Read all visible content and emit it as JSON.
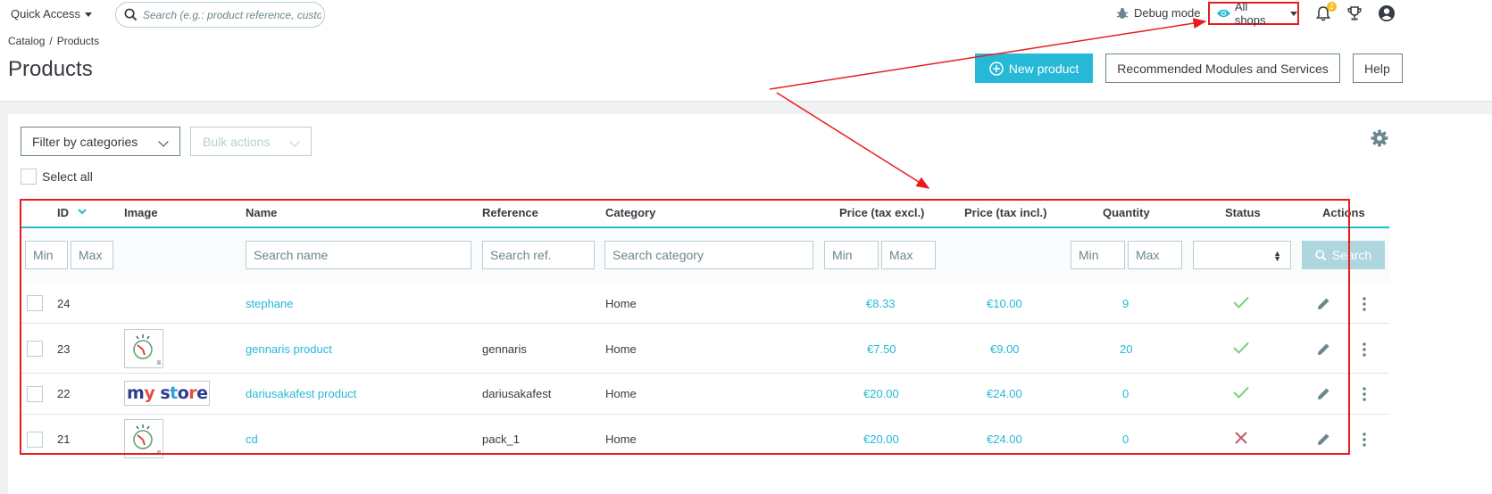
{
  "header": {
    "quick_access": "Quick Access",
    "search_placeholder": "Search (e.g.: product reference, custome",
    "debug_mode": "Debug mode",
    "shop_selector": "All shops",
    "notification_count": "2"
  },
  "breadcrumb": {
    "items": [
      "Catalog",
      "Products"
    ],
    "separator": "/"
  },
  "page": {
    "title": "Products",
    "new_product": "New product",
    "recommended": "Recommended Modules and Services",
    "help": "Help"
  },
  "toolbar": {
    "filter_by_categories": "Filter by categories",
    "bulk_actions": "Bulk actions",
    "select_all": "Select all"
  },
  "table": {
    "columns": [
      "ID",
      "Image",
      "Name",
      "Reference",
      "Category",
      "Price (tax excl.)",
      "Price (tax incl.)",
      "Quantity",
      "Status",
      "Actions"
    ],
    "filters": {
      "min": "Min",
      "max": "Max",
      "search_name": "Search name",
      "search_ref": "Search ref.",
      "search_category": "Search category",
      "search_button": "Search"
    },
    "rows": [
      {
        "id": "24",
        "image": "",
        "name": "stephane",
        "reference": "",
        "category": "Home",
        "price_excl": "€8.33",
        "price_incl": "€10.00",
        "quantity": "9",
        "status": "enabled"
      },
      {
        "id": "23",
        "image": "product-thumbnail",
        "name": "gennaris product",
        "reference": "gennaris",
        "category": "Home",
        "price_excl": "€7.50",
        "price_incl": "€9.00",
        "quantity": "20",
        "status": "enabled"
      },
      {
        "id": "22",
        "image": "my store",
        "name": "dariusakafest product",
        "reference": "dariusakafest",
        "category": "Home",
        "price_excl": "€20.00",
        "price_incl": "€24.00",
        "quantity": "0",
        "status": "enabled"
      },
      {
        "id": "21",
        "image": "product-thumbnail",
        "name": "cd",
        "reference": "pack_1",
        "category": "Home",
        "price_excl": "€20.00",
        "price_incl": "€24.00",
        "quantity": "0",
        "status": "disabled"
      }
    ]
  },
  "colors": {
    "accent": "#25b9d7",
    "annotation": "#e81c1c",
    "enabled": "#78d07d",
    "disabled": "#c05c67"
  }
}
